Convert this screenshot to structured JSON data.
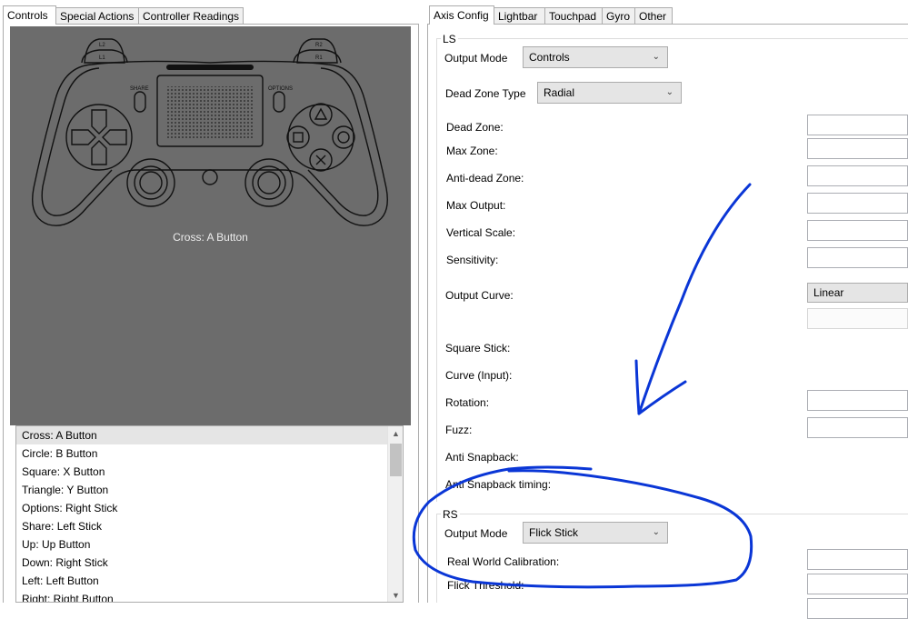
{
  "left_tabs": [
    "Controls",
    "Special Actions",
    "Controller Readings"
  ],
  "right_tabs": [
    "Axis Config",
    "Lightbar",
    "Touchpad",
    "Gyro",
    "Other"
  ],
  "controller": {
    "selected_label": "Cross: A Button",
    "l2": "L2",
    "l1": "L1",
    "r2": "R2",
    "r1": "R1",
    "share": "SHARE",
    "options": "OPTIONS"
  },
  "mappings": [
    "Cross: A Button",
    "Circle: B Button",
    "Square: X Button",
    "Triangle: Y Button",
    "Options: Right Stick",
    "Share: Left Stick",
    "Up: Up Button",
    "Down: Right Stick",
    "Left: Left Button",
    "Right: Right Button"
  ],
  "ls": {
    "group": "LS",
    "output_mode_label": "Output Mode",
    "output_mode_value": "Controls",
    "dead_zone_type_label": "Dead Zone Type",
    "dead_zone_type_value": "Radial",
    "dead_zone": "Dead Zone:",
    "max_zone": "Max Zone:",
    "anti_dead_zone": "Anti-dead Zone:",
    "max_output": "Max Output:",
    "vertical_scale": "Vertical Scale:",
    "sensitivity": "Sensitivity:",
    "output_curve": "Output Curve:",
    "output_curve_value": "Linear",
    "square_stick": "Square Stick:",
    "curve_input": "Curve (Input):",
    "rotation": "Rotation:",
    "fuzz": "Fuzz:",
    "anti_snapback": "Anti Snapback:",
    "anti_snapback_timing": "Anti Snapback timing:"
  },
  "rs": {
    "group": "RS",
    "output_mode_label": "Output Mode",
    "output_mode_value": "Flick Stick",
    "real_world_calibration": "Real World Calibration:",
    "flick_threshold": "Flick Threshold:"
  },
  "colors": {
    "controller_bg": "#6c6c6c",
    "annotation": "#0a36d6"
  }
}
